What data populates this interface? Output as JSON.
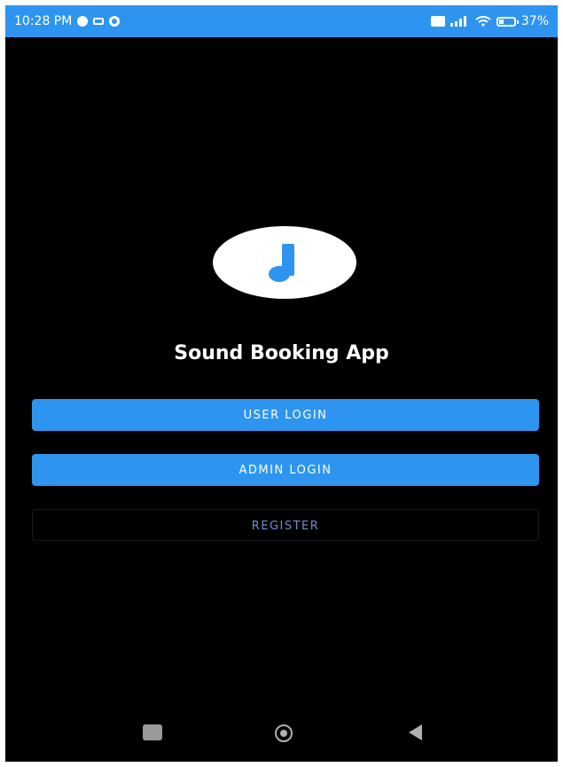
{
  "status_bar": {
    "time": "10:28 PM",
    "battery_level": "37",
    "battery_suffix": "%",
    "icons_left": [
      "whatsapp-icon",
      "message-icon",
      "settings-icon"
    ],
    "icons_right": [
      "hd-icon",
      "signal-icon",
      "wifi-icon",
      "battery-icon"
    ]
  },
  "app": {
    "logo_icon": "music-note-icon",
    "title": "Sound Booking App"
  },
  "buttons": {
    "user_login": "USER LOGIN",
    "admin_login": "ADMIN LOGIN",
    "register": "REGISTER"
  },
  "nav_bar": {
    "icons": [
      "recent-apps-icon",
      "home-icon",
      "back-icon"
    ]
  },
  "colors": {
    "accent": "#2d95ef",
    "background": "#000000",
    "register_text": "#6f8fc8"
  }
}
